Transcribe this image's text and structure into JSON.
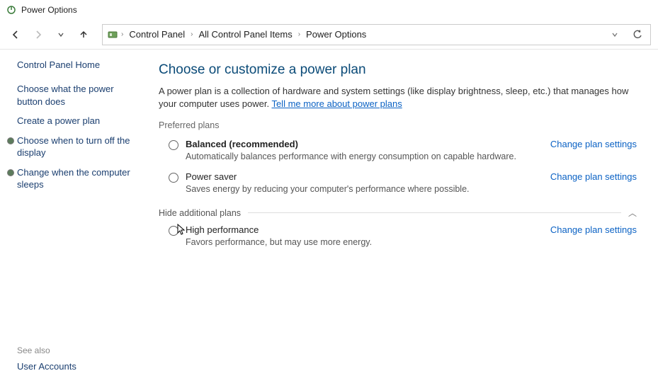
{
  "titlebar": {
    "title": "Power Options"
  },
  "breadcrumb": {
    "items": [
      "Control Panel",
      "All Control Panel Items",
      "Power Options"
    ]
  },
  "sidebar": {
    "home": "Control Panel Home",
    "links": [
      "Choose what the power button does",
      "Create a power plan",
      "Choose when to turn off the display",
      "Change when the computer sleeps"
    ],
    "see_also": "See also",
    "user_accounts": "User Accounts"
  },
  "main": {
    "heading": "Choose or customize a power plan",
    "description_pre": "A power plan is a collection of hardware and system settings (like display brightness, sleep, etc.) that manages how your computer uses power. ",
    "description_link": "Tell me more about power plans",
    "preferred_label": "Preferred plans",
    "hide_label": "Hide additional plans",
    "change_link": "Change plan settings",
    "plans_preferred": [
      {
        "name": "Balanced (recommended)",
        "bold": true,
        "desc": "Automatically balances performance with energy consumption on capable hardware."
      },
      {
        "name": "Power saver",
        "bold": false,
        "desc": "Saves energy by reducing your computer's performance where possible."
      }
    ],
    "plans_additional": [
      {
        "name": "High performance",
        "bold": false,
        "desc": "Favors performance, but may use more energy."
      }
    ]
  }
}
